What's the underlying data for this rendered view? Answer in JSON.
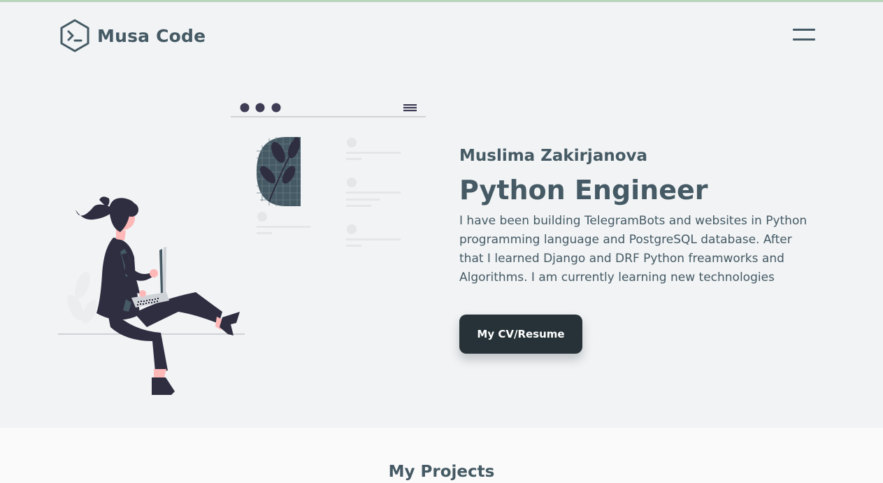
{
  "navbar": {
    "brand_name": "Musa Code",
    "logo_icon": "terminal-hexagon-icon",
    "menu_icon": "hamburger-menu-icon"
  },
  "hero": {
    "name": "Muslima Zakirjanova",
    "title": "Python Engineer",
    "description": "I have been building TelegramBots and websites in Python programming language and PostgreSQL database. After that I learned Django and DRF Python freamworks and Algorithms. I am currently learning new technologies",
    "cv_button_label": "My CV/Resume",
    "illustration": "woman-with-laptop-illustration"
  },
  "projects": {
    "heading": "My Projects"
  },
  "colors": {
    "primary_text": "#455a64",
    "button_bg": "#263238",
    "page_bg": "#f1f3f5",
    "section_bg": "#fafafa",
    "accent_line": "#b9d6bc"
  }
}
